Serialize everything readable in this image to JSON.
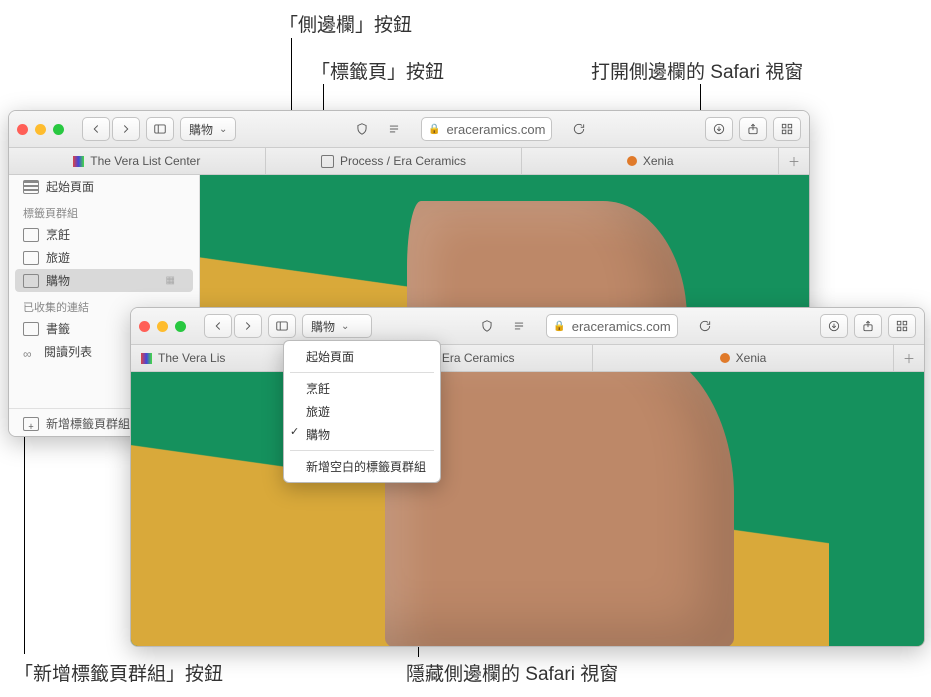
{
  "callouts": {
    "sidebar_button": "「側邊欄」按鈕",
    "tabs_button": "「標籤頁」按鈕",
    "open_sidebar_window": "打開側邊欄的 Safari 視窗",
    "new_tabgroup_button": "「新增標籤頁群組」按鈕",
    "hidden_sidebar_window": "隱藏側邊欄的 Safari 視窗"
  },
  "url_domain": "eraceramics.com",
  "tabs": {
    "vera": "The Vera List Center",
    "vera_short": "The Vera Lis",
    "era": "Process / Era Ceramics",
    "xenia": "Xenia"
  },
  "toolbar": {
    "group_name": "購物"
  },
  "sidebar": {
    "start_page": "起始頁面",
    "groups_header": "標籤頁群組",
    "groups": {
      "cook": "烹飪",
      "travel": "旅遊",
      "shop": "購物"
    },
    "collected_header": "已收集的連結",
    "bookmarks": "書籤",
    "reading_list": "閱讀列表",
    "new_group_button": "新增標籤頁群組"
  },
  "dropdown": {
    "start_page": "起始頁面",
    "cook": "烹飪",
    "travel": "旅遊",
    "shop": "購物",
    "new_blank_group": "新增空白的標籤頁群組"
  }
}
